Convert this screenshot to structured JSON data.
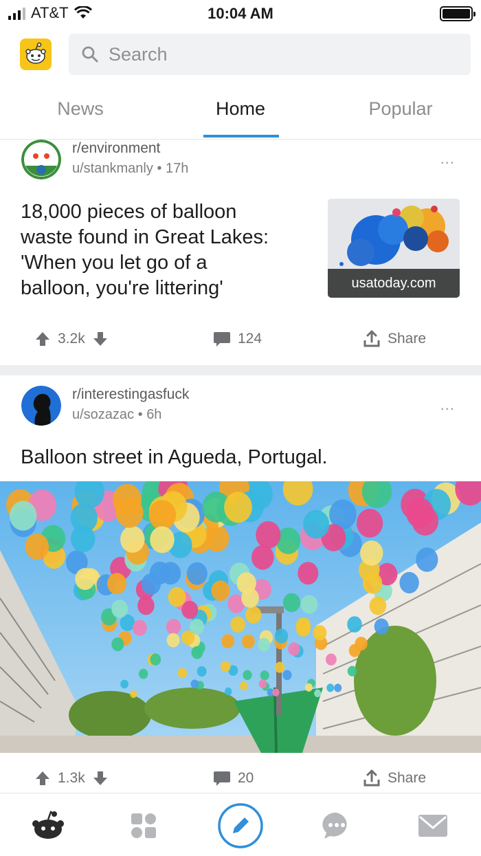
{
  "status_bar": {
    "carrier": "AT&T",
    "time": "10:04 AM",
    "battery_level": 1.0
  },
  "search": {
    "placeholder": "Search"
  },
  "tabs": [
    {
      "label": "News",
      "active": false
    },
    {
      "label": "Home",
      "active": true
    },
    {
      "label": "Popular",
      "active": false
    }
  ],
  "posts": [
    {
      "subreddit": "r/environment",
      "author": "u/stankmanly",
      "age": "17h",
      "title_lines": [
        "18,000 pieces of balloon",
        "waste found in Great Lakes:",
        "'When you let go of a",
        "balloon, you're littering'"
      ],
      "domain": "usatoday.com",
      "votes": "3.2k",
      "comments": "124",
      "share_label": "Share",
      "more_label": "..."
    },
    {
      "subreddit": "r/interestingasfuck",
      "author": "u/sozazac",
      "age": "6h",
      "title": "Balloon street in Agueda, Portugal.",
      "votes": "1.3k",
      "comments": "20",
      "share_label": "Share",
      "more_label": "..."
    }
  ],
  "colors": {
    "accent": "#2f8fd8",
    "logo_bg": "#f7c518",
    "text_muted": "#8b8d90"
  },
  "bottom_nav": [
    "reddit-alien-icon",
    "apps-grid-icon",
    "create-post-icon",
    "chat-icon",
    "mail-icon"
  ]
}
